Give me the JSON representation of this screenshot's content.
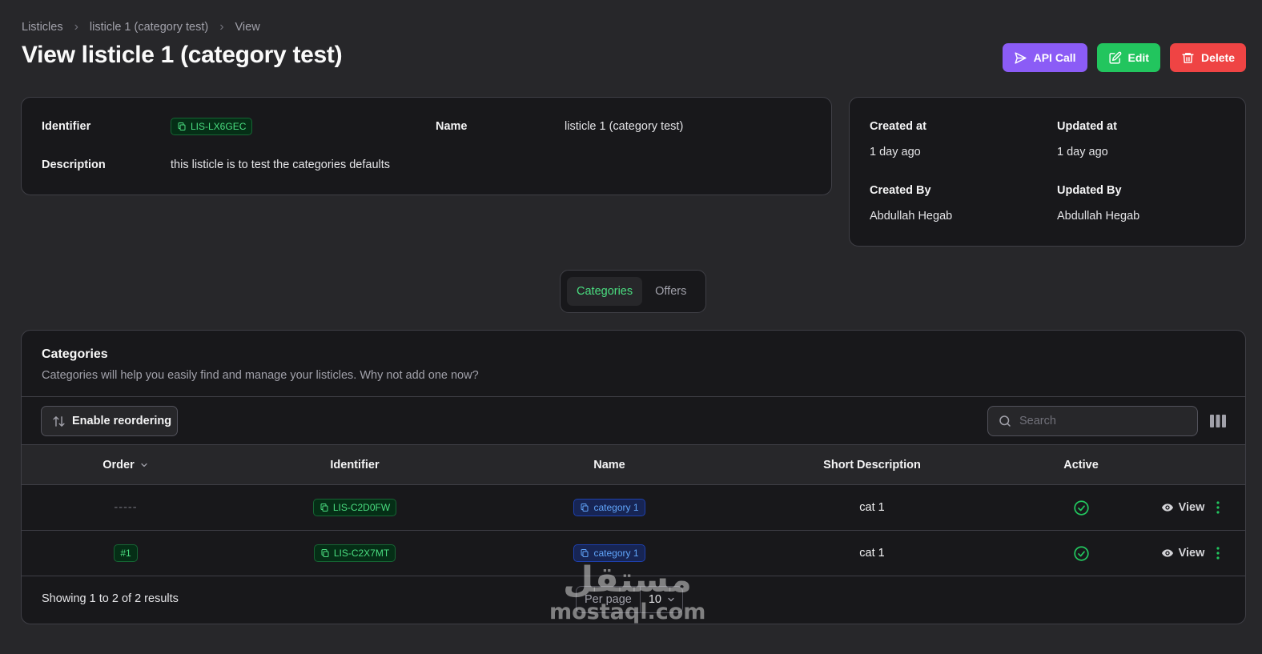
{
  "breadcrumb": {
    "items": [
      "Listicles",
      "listicle 1 (category test)",
      "View"
    ]
  },
  "page": {
    "title": "View listicle 1 (category test)"
  },
  "actions": {
    "api_call": "API Call",
    "edit": "Edit",
    "delete": "Delete"
  },
  "info": {
    "identifier_label": "Identifier",
    "identifier_value": "LIS-LX6GEC",
    "name_label": "Name",
    "name_value": "listicle 1 (category test)",
    "description_label": "Description",
    "description_value": "this listicle is to test the categories defaults"
  },
  "meta": {
    "created_at_label": "Created at",
    "created_at_value": "1 day ago",
    "updated_at_label": "Updated at",
    "updated_at_value": "1 day ago",
    "created_by_label": "Created By",
    "created_by_value": "Abdullah Hegab",
    "updated_by_label": "Updated By",
    "updated_by_value": "Abdullah Hegab"
  },
  "tabs": [
    {
      "label": "Categories",
      "active": true
    },
    {
      "label": "Offers",
      "active": false
    }
  ],
  "categories": {
    "title": "Categories",
    "description": "Categories will help you easily find and manage your listicles. Why not add one now?",
    "reorder_label": "Enable reordering",
    "search_placeholder": "Search",
    "columns": [
      "Order",
      "Identifier",
      "Name",
      "Short Description",
      "Active"
    ],
    "rows": [
      {
        "order": "-----",
        "identifier": "LIS-C2D0FW",
        "name": "category 1",
        "short_description": "cat 1",
        "active": true,
        "view_label": "View"
      },
      {
        "order": "#1",
        "identifier": "LIS-C2X7MT",
        "name": "category 1",
        "short_description": "cat 1",
        "active": true,
        "view_label": "View"
      }
    ],
    "footer": {
      "showing": "Showing 1 to 2 of 2 results",
      "per_page_label": "Per page",
      "per_page_value": "10"
    }
  },
  "watermark": {
    "arabic": "مستقل",
    "latin": "mostaql.com"
  },
  "colors": {
    "accent_green": "#22c55e",
    "accent_purple": "#8b5cf6",
    "accent_red": "#ef4444",
    "badge_blue": "#60a5fa"
  }
}
